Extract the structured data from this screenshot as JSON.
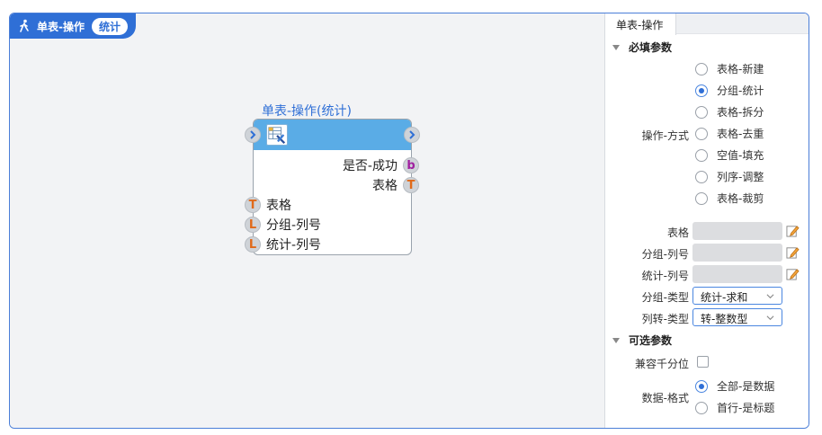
{
  "header": {
    "title": "单表-操作",
    "badge": "统计"
  },
  "node": {
    "title": "单表-操作(统计)",
    "outputs": [
      {
        "label": "是否-成功",
        "type": "b"
      },
      {
        "label": "表格",
        "type": "T"
      }
    ],
    "inputs": [
      {
        "label": "表格",
        "type": "T"
      },
      {
        "label": "分组-列号",
        "type": "L"
      },
      {
        "label": "统计-列号",
        "type": "L"
      }
    ]
  },
  "panel": {
    "tab": "单表-操作",
    "required_section": "必填参数",
    "operation_label": "操作-方式",
    "operations": [
      "表格-新建",
      "分组-统计",
      "表格-拆分",
      "表格-去重",
      "空值-填充",
      "列序-调整",
      "表格-裁剪"
    ],
    "operation_selected": "分组-统计",
    "fields": [
      "表格",
      "分组-列号",
      "统计-列号"
    ],
    "group_type_label": "分组-类型",
    "group_type_value": "统计-求和",
    "col_type_label": "列转-类型",
    "col_type_value": "转-整数型",
    "optional_section": "可选参数",
    "thousands_label": "兼容千分位",
    "thousands_checked": false,
    "format_label": "数据-格式",
    "formats": [
      "全部-是数据",
      "首行-是标题"
    ],
    "format_selected": "全部-是数据"
  },
  "colors": {
    "accent": "#2f6fd6",
    "node_header": "#5aace6",
    "port_text_T": "#e06a1a",
    "port_text_b": "#a020a0"
  }
}
